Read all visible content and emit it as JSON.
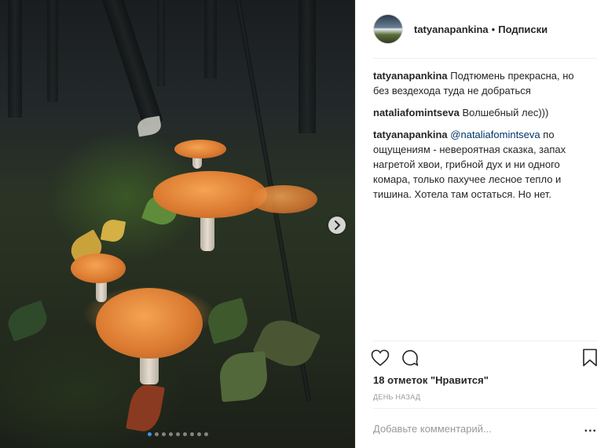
{
  "carousel": {
    "dot_count": 9,
    "active_index": 0
  },
  "header": {
    "username": "tatyanapankina",
    "separator": "•",
    "follow_label": "Подписки"
  },
  "comments": [
    {
      "author": "tatyanapankina",
      "text": "Подтюмень прекрасна, но без вездехода туда не добраться"
    },
    {
      "author": "nataliafomintseva",
      "text": "Волшебный лес)))"
    },
    {
      "author": "tatyanapankina",
      "mention": "@nataliafomintseva",
      "text": "по ощущениям - невероятная сказка, запах нагретой хвои, грибной дух и ни одного комара, только пахучее лесное тепло и тишина. Хотела там остаться. Но нет."
    }
  ],
  "actions": {
    "like_icon": "heart-icon",
    "comment_icon": "comment-icon",
    "save_icon": "bookmark-icon"
  },
  "likes_text": "18 отметок \"Нравится\"",
  "time_text": "ДЕНЬ НАЗАД",
  "comment_box": {
    "placeholder": "Добавьте комментарий...",
    "more_label": "..."
  },
  "colors": {
    "link": "#003569",
    "active_dot": "#3897f0",
    "muted": "#999999"
  }
}
